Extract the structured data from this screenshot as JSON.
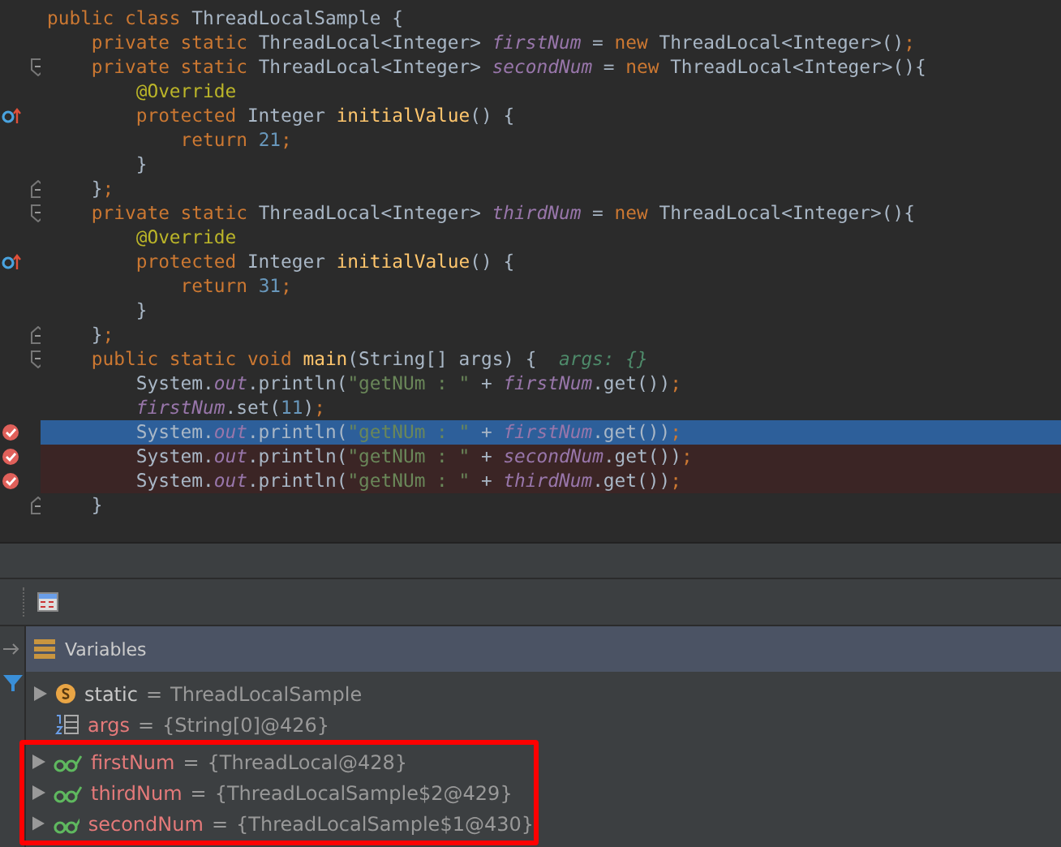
{
  "editor": {
    "lines": [
      {
        "override": false,
        "breakpoint": false,
        "current": false,
        "fold_start": false,
        "fold_end": false,
        "tokens": [
          {
            "kind": "keyword",
            "text": "public class "
          },
          {
            "kind": "plain",
            "text": "ThreadLocalSample {"
          }
        ]
      },
      {
        "override": false,
        "breakpoint": false,
        "current": false,
        "fold_start": false,
        "fold_end": false,
        "tokens": [
          {
            "kind": "keyword",
            "text": "    private static "
          },
          {
            "kind": "plain",
            "text": "ThreadLocal<Integer> "
          },
          {
            "kind": "field",
            "text": "firstNum"
          },
          {
            "kind": "plain",
            "text": " = "
          },
          {
            "kind": "keyword",
            "text": "new "
          },
          {
            "kind": "plain",
            "text": "ThreadLocal<Integer>()"
          },
          {
            "kind": "keyword",
            "text": ";"
          }
        ]
      },
      {
        "override": false,
        "breakpoint": false,
        "current": false,
        "fold_start": true,
        "fold_end": false,
        "tokens": [
          {
            "kind": "keyword",
            "text": "    private static "
          },
          {
            "kind": "plain",
            "text": "ThreadLocal<Integer> "
          },
          {
            "kind": "field",
            "text": "secondNum"
          },
          {
            "kind": "plain",
            "text": " = "
          },
          {
            "kind": "keyword",
            "text": "new "
          },
          {
            "kind": "plain",
            "text": "ThreadLocal<Integer>(){"
          }
        ]
      },
      {
        "override": false,
        "breakpoint": false,
        "current": false,
        "fold_start": false,
        "fold_end": false,
        "tokens": [
          {
            "kind": "annotation",
            "text": "        @Override"
          }
        ]
      },
      {
        "override": true,
        "breakpoint": false,
        "current": false,
        "fold_start": false,
        "fold_end": false,
        "tokens": [
          {
            "kind": "keyword",
            "text": "        protected "
          },
          {
            "kind": "plain",
            "text": "Integer "
          },
          {
            "kind": "method",
            "text": "initialValue"
          },
          {
            "kind": "plain",
            "text": "() {"
          }
        ]
      },
      {
        "override": false,
        "breakpoint": false,
        "current": false,
        "fold_start": false,
        "fold_end": false,
        "tokens": [
          {
            "kind": "keyword",
            "text": "            return "
          },
          {
            "kind": "number",
            "text": "21"
          },
          {
            "kind": "keyword",
            "text": ";"
          }
        ]
      },
      {
        "override": false,
        "breakpoint": false,
        "current": false,
        "fold_start": false,
        "fold_end": false,
        "tokens": [
          {
            "kind": "plain",
            "text": "        }"
          }
        ]
      },
      {
        "override": false,
        "breakpoint": false,
        "current": false,
        "fold_start": false,
        "fold_end": true,
        "tokens": [
          {
            "kind": "plain",
            "text": "    }"
          },
          {
            "kind": "keyword",
            "text": ";"
          }
        ]
      },
      {
        "override": false,
        "breakpoint": false,
        "current": false,
        "fold_start": true,
        "fold_end": false,
        "tokens": [
          {
            "kind": "keyword",
            "text": "    private static "
          },
          {
            "kind": "plain",
            "text": "ThreadLocal<Integer> "
          },
          {
            "kind": "field",
            "text": "thirdNum"
          },
          {
            "kind": "plain",
            "text": " = "
          },
          {
            "kind": "keyword",
            "text": "new "
          },
          {
            "kind": "plain",
            "text": "ThreadLocal<Integer>(){"
          }
        ]
      },
      {
        "override": false,
        "breakpoint": false,
        "current": false,
        "fold_start": false,
        "fold_end": false,
        "tokens": [
          {
            "kind": "annotation",
            "text": "        @Override"
          }
        ]
      },
      {
        "override": true,
        "breakpoint": false,
        "current": false,
        "fold_start": false,
        "fold_end": false,
        "tokens": [
          {
            "kind": "keyword",
            "text": "        protected "
          },
          {
            "kind": "plain",
            "text": "Integer "
          },
          {
            "kind": "method",
            "text": "initialValue"
          },
          {
            "kind": "plain",
            "text": "() {"
          }
        ]
      },
      {
        "override": false,
        "breakpoint": false,
        "current": false,
        "fold_start": false,
        "fold_end": false,
        "tokens": [
          {
            "kind": "keyword",
            "text": "            return "
          },
          {
            "kind": "number",
            "text": "31"
          },
          {
            "kind": "keyword",
            "text": ";"
          }
        ]
      },
      {
        "override": false,
        "breakpoint": false,
        "current": false,
        "fold_start": false,
        "fold_end": false,
        "tokens": [
          {
            "kind": "plain",
            "text": "        }"
          }
        ]
      },
      {
        "override": false,
        "breakpoint": false,
        "current": false,
        "fold_start": false,
        "fold_end": true,
        "tokens": [
          {
            "kind": "plain",
            "text": "    }"
          },
          {
            "kind": "keyword",
            "text": ";"
          }
        ]
      },
      {
        "override": false,
        "breakpoint": false,
        "current": false,
        "fold_start": true,
        "fold_end": false,
        "tokens": [
          {
            "kind": "keyword",
            "text": "    public static void "
          },
          {
            "kind": "method",
            "text": "main"
          },
          {
            "kind": "plain",
            "text": "(String[] args) {  "
          },
          {
            "kind": "hint",
            "text": "args: {}"
          }
        ]
      },
      {
        "override": false,
        "breakpoint": false,
        "current": false,
        "fold_start": false,
        "fold_end": false,
        "tokens": [
          {
            "kind": "plain",
            "text": "        System."
          },
          {
            "kind": "field",
            "text": "out"
          },
          {
            "kind": "plain",
            "text": ".println("
          },
          {
            "kind": "string",
            "text": "\"getNUm : \""
          },
          {
            "kind": "plain",
            "text": " + "
          },
          {
            "kind": "field",
            "text": "firstNum"
          },
          {
            "kind": "plain",
            "text": ".get())"
          },
          {
            "kind": "keyword",
            "text": ";"
          }
        ]
      },
      {
        "override": false,
        "breakpoint": false,
        "current": false,
        "fold_start": false,
        "fold_end": false,
        "tokens": [
          {
            "kind": "field",
            "text": "        firstNum"
          },
          {
            "kind": "plain",
            "text": ".set("
          },
          {
            "kind": "number",
            "text": "11"
          },
          {
            "kind": "plain",
            "text": ")"
          },
          {
            "kind": "keyword",
            "text": ";"
          }
        ]
      },
      {
        "override": false,
        "breakpoint": true,
        "current": true,
        "fold_start": false,
        "fold_end": false,
        "tokens": [
          {
            "kind": "plain",
            "text": "        System."
          },
          {
            "kind": "field",
            "text": "out"
          },
          {
            "kind": "plain",
            "text": ".println("
          },
          {
            "kind": "string",
            "text": "\"getNUm : \""
          },
          {
            "kind": "plain",
            "text": " + "
          },
          {
            "kind": "field",
            "text": "firstNum"
          },
          {
            "kind": "plain",
            "text": ".get())"
          },
          {
            "kind": "keyword",
            "text": ";"
          }
        ]
      },
      {
        "override": false,
        "breakpoint": true,
        "current": false,
        "fold_start": false,
        "fold_end": false,
        "tokens": [
          {
            "kind": "plain",
            "text": "        System."
          },
          {
            "kind": "field",
            "text": "out"
          },
          {
            "kind": "plain",
            "text": ".println("
          },
          {
            "kind": "string",
            "text": "\"getNUm : \""
          },
          {
            "kind": "plain",
            "text": " + "
          },
          {
            "kind": "field",
            "text": "secondNum"
          },
          {
            "kind": "plain",
            "text": ".get())"
          },
          {
            "kind": "keyword",
            "text": ";"
          }
        ]
      },
      {
        "override": false,
        "breakpoint": true,
        "current": false,
        "fold_start": false,
        "fold_end": false,
        "tokens": [
          {
            "kind": "plain",
            "text": "        System."
          },
          {
            "kind": "field",
            "text": "out"
          },
          {
            "kind": "plain",
            "text": ".println("
          },
          {
            "kind": "string",
            "text": "\"getNUm : \""
          },
          {
            "kind": "plain",
            "text": " + "
          },
          {
            "kind": "field",
            "text": "thirdNum"
          },
          {
            "kind": "plain",
            "text": ".get())"
          },
          {
            "kind": "keyword",
            "text": ";"
          }
        ]
      },
      {
        "override": false,
        "breakpoint": false,
        "current": false,
        "fold_start": false,
        "fold_end": true,
        "tokens": [
          {
            "kind": "plain",
            "text": "    }"
          }
        ]
      }
    ]
  },
  "variables": {
    "title": "Variables",
    "items": [
      {
        "kind": "static",
        "expandable": true,
        "outlined": false,
        "name": "static",
        "operator": "=",
        "value": "ThreadLocalSample"
      },
      {
        "kind": "array",
        "expandable": false,
        "outlined": false,
        "name": "args",
        "operator": "=",
        "value": "{String[0]@426}"
      },
      {
        "kind": "field",
        "expandable": true,
        "outlined": true,
        "name": "firstNum",
        "operator": "=",
        "value": "{ThreadLocal@428}"
      },
      {
        "kind": "field",
        "expandable": true,
        "outlined": true,
        "name": "thirdNum",
        "operator": "=",
        "value": "{ThreadLocalSample$2@429}"
      },
      {
        "kind": "field",
        "expandable": true,
        "outlined": true,
        "name": "secondNum",
        "operator": "=",
        "value": "{ThreadLocalSample$1@430}"
      }
    ]
  }
}
